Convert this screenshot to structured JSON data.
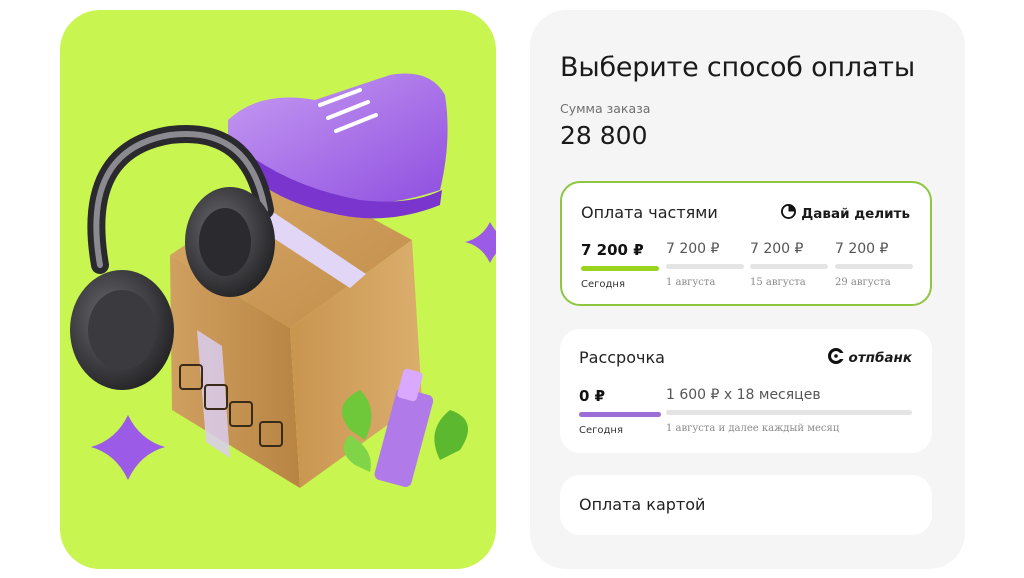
{
  "header": {
    "title": "Выберите способ оплаты"
  },
  "order": {
    "sum_label": "Сумма заказа",
    "sum_value": "28 800"
  },
  "options": {
    "parts": {
      "title": "Оплата частями",
      "brand": "Давай делить",
      "brand_icon": "pie-chart-icon",
      "payments": [
        {
          "amount": "7 200 ₽",
          "date": "Сегодня",
          "progress": 1.0
        },
        {
          "amount": "7 200 ₽",
          "date": "1 августа",
          "progress": 0
        },
        {
          "amount": "7 200 ₽",
          "date": "15 августа",
          "progress": 0
        },
        {
          "amount": "7 200 ₽",
          "date": "29 августа",
          "progress": 0
        }
      ]
    },
    "installment": {
      "title": "Рассрочка",
      "brand": "отпбанк",
      "brand_icon": "otp-logo-icon",
      "first_amount": "0 ₽",
      "first_date": "Сегодня",
      "rest_amount": "1 600 ₽ x 18 месяцев",
      "rest_date": "1 августа и далее каждый месяц"
    },
    "card": {
      "title": "Оплата картой"
    }
  },
  "colors": {
    "promo_bg": "#c8f550",
    "parts_accent": "#9ad41e",
    "installment_accent": "#9b6fd6",
    "selected_border": "#8ec63f"
  }
}
